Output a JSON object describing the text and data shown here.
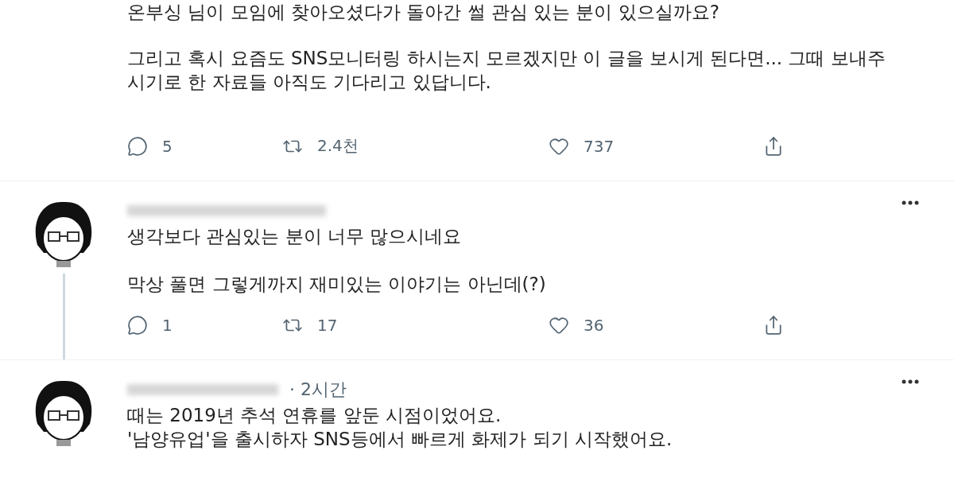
{
  "tweet": {
    "paragraphs": [
      "온부싱 님이 모임에 찾아오셨다가 돌아간 썰 관심 있는 분이 있으실까요?",
      "그리고 혹시 요즘도 SNS모니터링 하시는지 모르겠지만 이 글을 보시게 된다면... 그때 보내주시기로 한 자료들 아직도 기다리고 있답니다."
    ],
    "actions": [
      {
        "kind": "reply",
        "count": "5"
      },
      {
        "kind": "retweet",
        "count": "2.4천"
      },
      {
        "kind": "like",
        "count": "737"
      },
      {
        "kind": "share"
      }
    ]
  },
  "replies": [
    {
      "paragraphs": [
        "생각보다 관심있는 분이 너무 많으시네요",
        "막상 풀면 그렇게까지 재미있는 이야기는 아닌데(?)"
      ],
      "actions": [
        {
          "kind": "reply",
          "count": "1"
        },
        {
          "kind": "retweet",
          "count": "17"
        },
        {
          "kind": "like",
          "count": "36"
        },
        {
          "kind": "share"
        }
      ]
    },
    {
      "time": "· 2시간",
      "lines": [
        "때는 2019년 추석 연휴를 앞둔 시점이었어요.",
        "'남양유업'을 출시하자 SNS등에서 빠르게 화제가 되기 시작했어요."
      ]
    }
  ]
}
